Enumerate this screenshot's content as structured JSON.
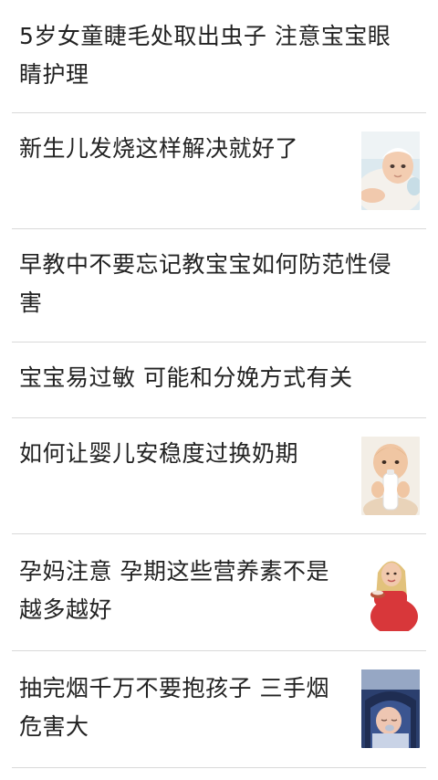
{
  "articles": [
    {
      "title": "5岁女童睫毛处取出虫子 注意宝宝眼睛护理",
      "thumbnail": null
    },
    {
      "title": "新生儿发烧这样解决就好了",
      "thumbnail": "baby-in-blanket-photo"
    },
    {
      "title": "早教中不要忘记教宝宝如何防范性侵害",
      "thumbnail": null
    },
    {
      "title": "宝宝易过敏 可能和分娩方式有关",
      "thumbnail": null
    },
    {
      "title": "如何让婴儿安稳度过换奶期",
      "thumbnail": "baby-with-milk-bottle-photo"
    },
    {
      "title": "孕妈注意 孕期这些营养素不是越多越好",
      "thumbnail": "pregnant-woman-eating-photo"
    },
    {
      "title": "抽完烟千万不要抱孩子 三手烟危害大",
      "thumbnail": "sleeping-baby-in-car-seat-photo"
    }
  ]
}
